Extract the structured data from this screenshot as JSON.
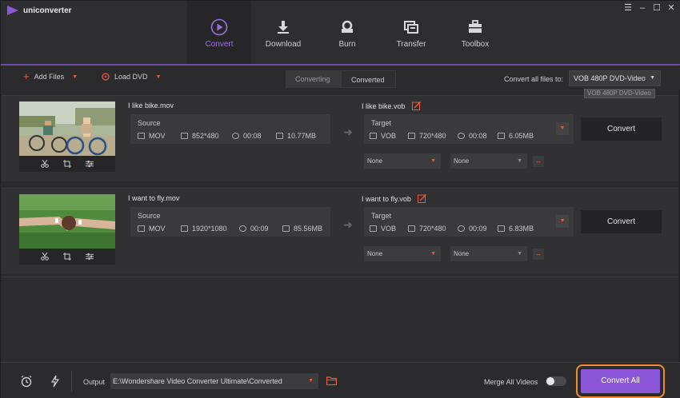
{
  "app": {
    "title": "uniconverter"
  },
  "nav": {
    "tabs": [
      {
        "label": "Convert",
        "icon": "convert-icon",
        "active": true
      },
      {
        "label": "Download",
        "icon": "download-icon",
        "active": false
      },
      {
        "label": "Burn",
        "icon": "burn-icon",
        "active": false
      },
      {
        "label": "Transfer",
        "icon": "transfer-icon",
        "active": false
      },
      {
        "label": "Toolbox",
        "icon": "toolbox-icon",
        "active": false
      }
    ]
  },
  "toolbar": {
    "add_files": "Add Files",
    "load_dvd": "Load DVD",
    "tab_converting": "Converting",
    "tab_converted": "Converted",
    "convert_all_to_label": "Convert all files to:",
    "format_value": "VOB 480P DVD-Video",
    "format_tooltip": "VOB 480P DVD-Video"
  },
  "files": [
    {
      "source_name": "I like bike.mov",
      "source_label": "Source",
      "source_format": "MOV",
      "source_resolution": "852*480",
      "source_duration": "00:08",
      "source_size": "10.77MB",
      "target_name": "I like bike.vob",
      "target_label": "Target",
      "target_format": "VOB",
      "target_resolution": "720*480",
      "target_duration": "00:08",
      "target_size": "6.05MB",
      "convert_label": "Convert",
      "subtitle_value": "None",
      "audio_value": "None"
    },
    {
      "source_name": "I want to fly.mov",
      "source_label": "Source",
      "source_format": "MOV",
      "source_resolution": "1920*1080",
      "source_duration": "00:09",
      "source_size": "85.56MB",
      "target_name": "I want to fly.vob",
      "target_label": "Target",
      "target_format": "VOB",
      "target_resolution": "720*480",
      "target_duration": "00:09",
      "target_size": "6.83MB",
      "convert_label": "Convert",
      "subtitle_value": "None",
      "audio_value": "None"
    }
  ],
  "bottom": {
    "output_label": "Output",
    "output_path": "E:\\Wondershare Video Converter Ultimate\\Converted",
    "merge_label": "Merge All Videos",
    "merge_enabled": false,
    "convert_all_label": "Convert All"
  },
  "colors": {
    "accent_purple": "#8b56d8",
    "accent_orange": "#ef5b3b",
    "highlight_ring": "#f08a2b",
    "background": "#2b2b2d"
  }
}
